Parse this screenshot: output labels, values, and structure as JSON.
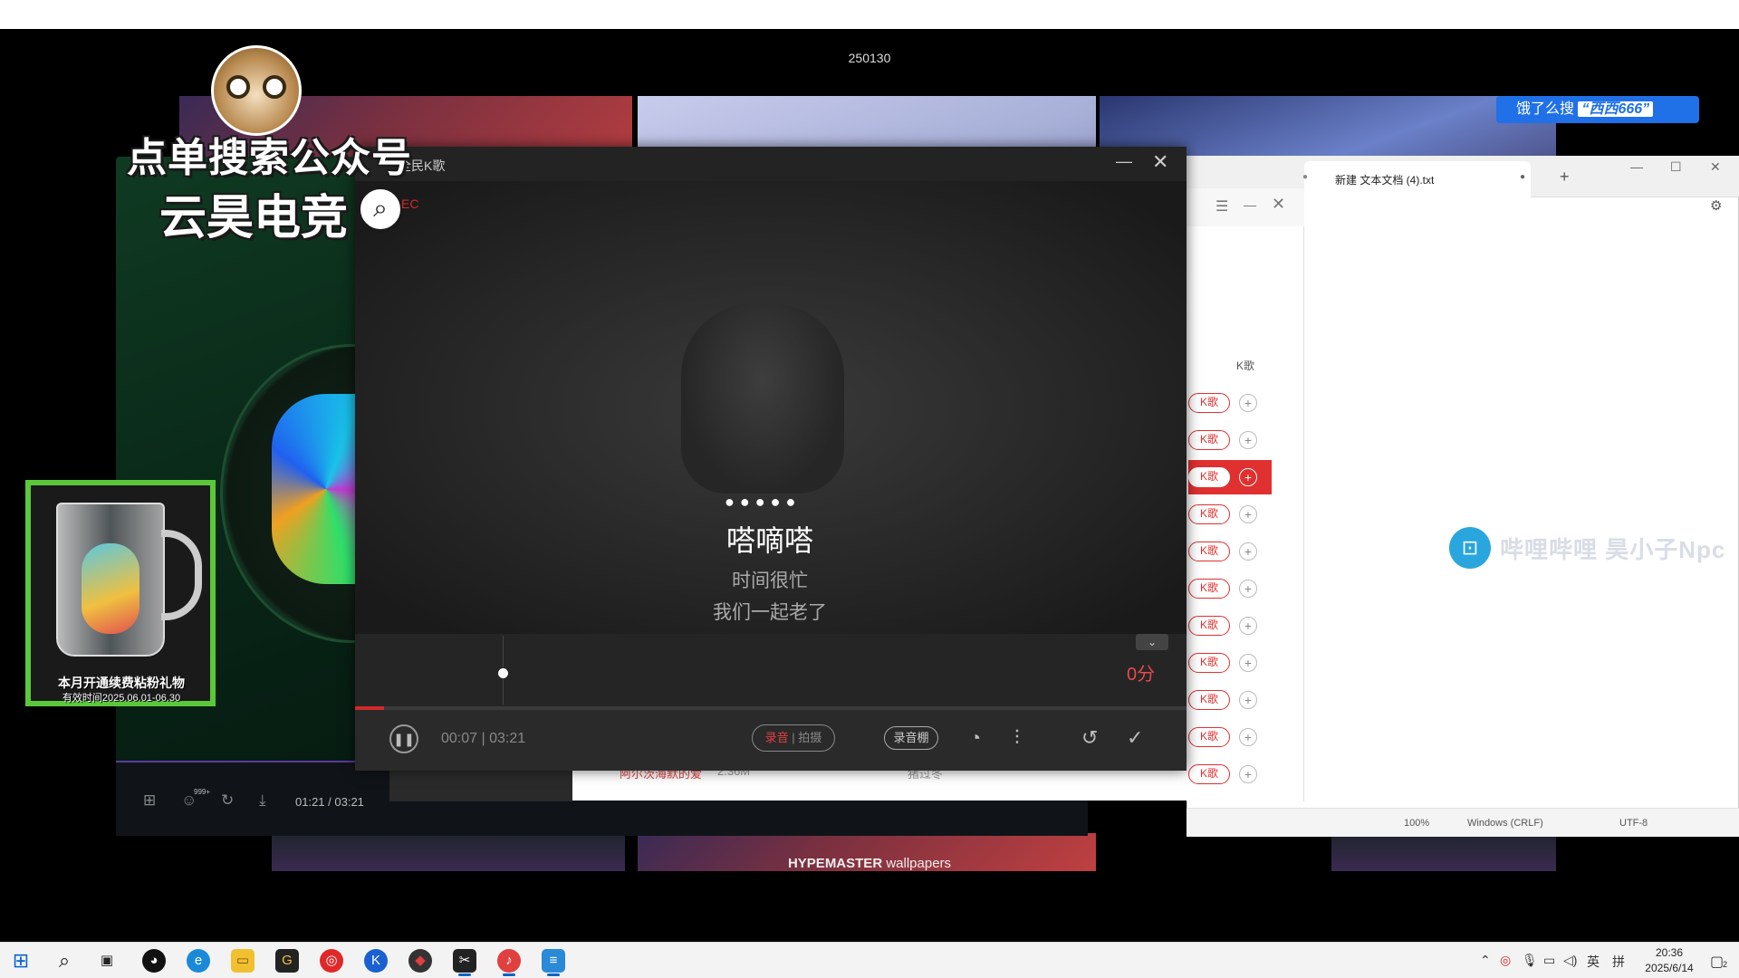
{
  "screen_label": "250130",
  "wallpaper_caption": {
    "brand": "HYPEMASTER",
    "text": " wallpapers"
  },
  "overlay": {
    "promo_line1": "点单搜索公众号",
    "promo_line2": "云昊电竞",
    "search_tag_prefix": "饿了么搜",
    "search_tag_highlight": "“西西666”",
    "mug_line1": "本月开通续费粘粉礼物",
    "mug_line2": "有效时间2025.06.01-06.30",
    "rec_badge": "EC"
  },
  "karaoke": {
    "title": "全民K歌",
    "lyrics": {
      "current": "嗒嘀嗒",
      "next": "时间很忙",
      "after": "我们一起老了"
    },
    "score": "0分",
    "time_current": "00:07",
    "time_separator": "|",
    "time_total": "03:21",
    "record_audio": "录音",
    "record_video": "拍摄",
    "studio": "录音棚",
    "collapse_icon": "chevron-down-icon"
  },
  "background_player": {
    "time": "01:21 / 03:21",
    "badge": "999+"
  },
  "song_list": {
    "column_label": "K歌",
    "k_button": "K歌",
    "plus": "+",
    "row_count_label": "",
    "visible_song": {
      "title": "阿尔茨海默的爱",
      "size": "2.36M",
      "artist": "猪过冬"
    }
  },
  "notepad": {
    "tab_title": "新建 文本文档 (4).txt",
    "status_zoom": "100%",
    "status_eol": "Windows (CRLF)",
    "status_encoding": "UTF-8"
  },
  "bilibili_watermark": "哔哩哔哩 昊小子Npc",
  "taskbar": {
    "ime": "英",
    "ime_mode": "拼",
    "time": "20:36",
    "date": "2025/6/14",
    "notification_count": "2"
  }
}
